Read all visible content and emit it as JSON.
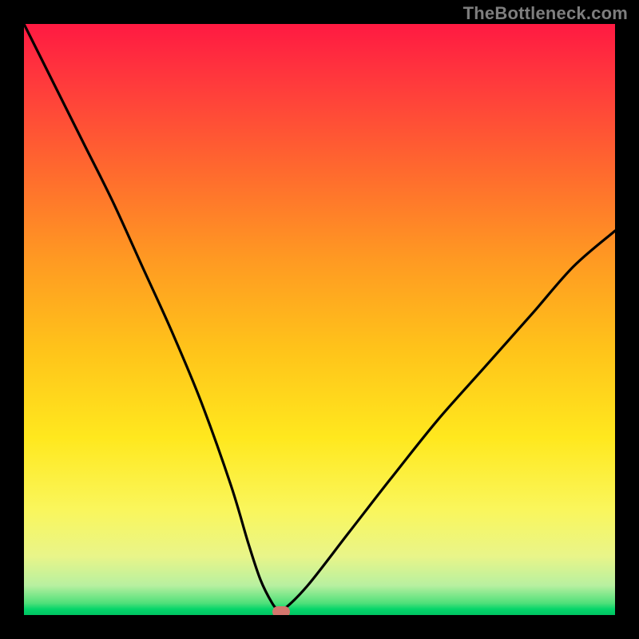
{
  "watermark": "TheBottleneck.com",
  "chart_data": {
    "type": "line",
    "title": "",
    "xlabel": "",
    "ylabel": "",
    "xlim": [
      0,
      100
    ],
    "ylim": [
      0,
      100
    ],
    "grid": false,
    "legend": false,
    "series": [
      {
        "name": "bottleneck-curve",
        "x": [
          0,
          5,
          10,
          15,
          20,
          25,
          30,
          35,
          38,
          40,
          42,
          43,
          44,
          48,
          55,
          62,
          70,
          78,
          86,
          93,
          100
        ],
        "values": [
          100,
          90,
          80,
          70,
          59,
          48,
          36,
          22,
          12,
          6,
          2,
          1,
          1,
          5,
          14,
          23,
          33,
          42,
          51,
          59,
          65
        ]
      }
    ],
    "marker": {
      "x": 43.5,
      "y": 0.5
    },
    "gradient_stops": [
      {
        "pos": 0,
        "color": "#ff1a42"
      },
      {
        "pos": 10,
        "color": "#ff3a3c"
      },
      {
        "pos": 25,
        "color": "#ff6a2e"
      },
      {
        "pos": 40,
        "color": "#ff9a22"
      },
      {
        "pos": 55,
        "color": "#ffc31a"
      },
      {
        "pos": 70,
        "color": "#ffe81e"
      },
      {
        "pos": 82,
        "color": "#faf65b"
      },
      {
        "pos": 90,
        "color": "#e9f589"
      },
      {
        "pos": 95,
        "color": "#b8f0a0"
      },
      {
        "pos": 98,
        "color": "#4fe07a"
      },
      {
        "pos": 99,
        "color": "#05d56a"
      },
      {
        "pos": 100,
        "color": "#00c462"
      }
    ]
  }
}
